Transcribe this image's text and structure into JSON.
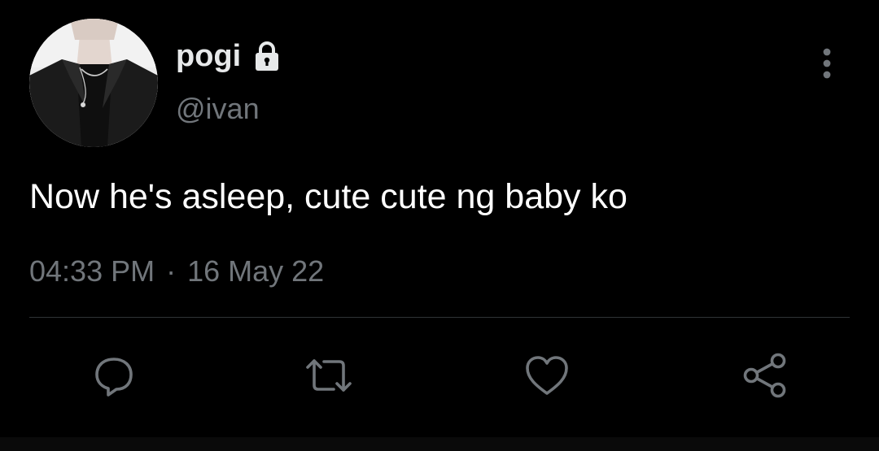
{
  "user": {
    "display_name": "pogi",
    "handle": "@ivan",
    "avatar": "avatar-photo",
    "protected_icon": "lock-icon"
  },
  "tweet": {
    "text": "Now he's asleep, cute cute ng baby ko",
    "time": "04:33 PM",
    "separator": "·",
    "date": "16 May 22"
  },
  "menu": {
    "icon": "more-vertical-icon"
  },
  "actions": [
    {
      "name": "reply",
      "icon": "comment-icon"
    },
    {
      "name": "retweet",
      "icon": "retweet-icon"
    },
    {
      "name": "like",
      "icon": "heart-icon"
    },
    {
      "name": "share",
      "icon": "share-icon"
    }
  ],
  "colors": {
    "background": "#000000",
    "primary_text": "#e7e9ea",
    "secondary_text": "#71767b",
    "divider": "#2f3336"
  }
}
